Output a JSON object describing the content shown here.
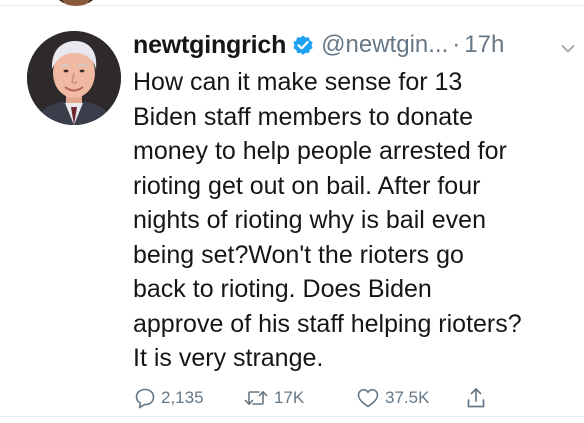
{
  "tweet": {
    "display_name": "newtgingrich",
    "handle": "@newtgin...",
    "separator": "·",
    "timestamp": "17h",
    "text_lines": [
      "How can it make sense for 13",
      "Biden staff members to donate",
      "money to help people arrested for",
      "rioting get out on bail. After four",
      "nights of rioting why is bail even",
      "being set?Won't the rioters go",
      "back to rioting. Does Biden",
      "approve of his staff helping rioters?",
      "It is very strange."
    ],
    "verified": true
  },
  "actions": {
    "replies": "2,135",
    "retweets": "17K",
    "likes": "37.5K"
  },
  "icons": {
    "reply": "reply-icon",
    "retweet": "retweet-icon",
    "like": "heart-icon",
    "share": "share-icon",
    "verified": "verified-badge-icon",
    "menu": "chevron-down-icon"
  },
  "colors": {
    "text": "#14171a",
    "secondary": "#657786",
    "verified_blue": "#1da1f2",
    "separator": "#e6ecf0"
  }
}
